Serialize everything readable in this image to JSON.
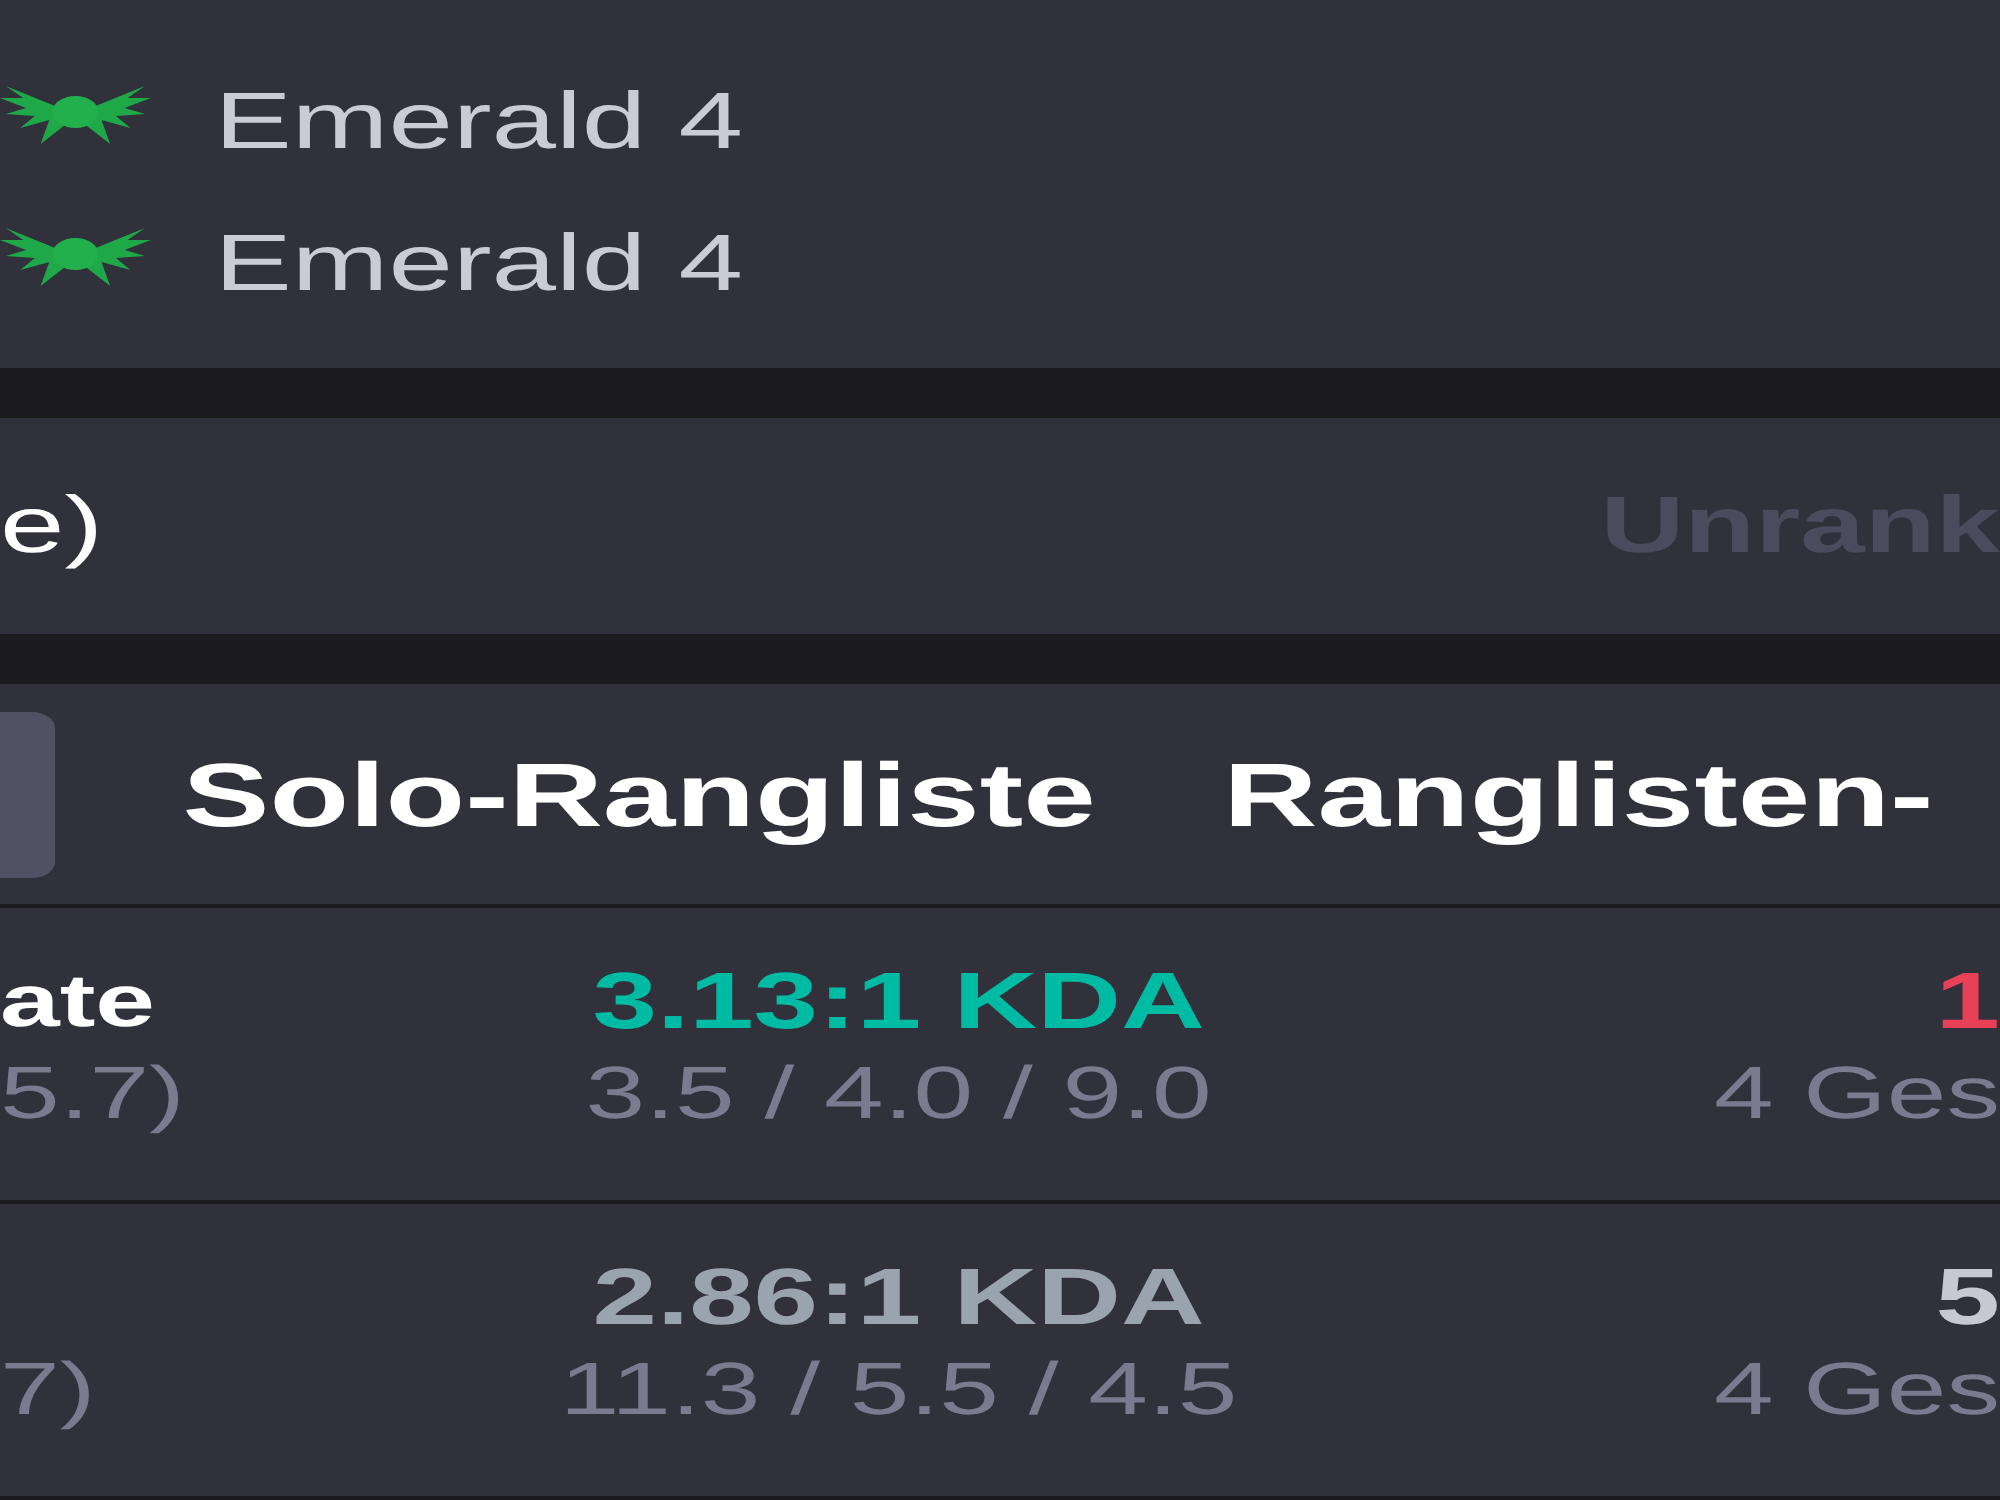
{
  "tier_list": {
    "rows": [
      {
        "tier": "Emerald 4"
      },
      {
        "tier": "Emerald 4"
      }
    ]
  },
  "queue_panel": {
    "title": "e)",
    "status": "Unrank"
  },
  "tabs": [
    {
      "selected": true
    },
    {
      "label": "Solo-Rangliste",
      "selected": false
    },
    {
      "label": "Ranglisten-",
      "selected": false
    }
  ],
  "champion_table": {
    "rows": [
      {
        "name": "ate",
        "cs": "5.7)",
        "kda": {
          "text": "3.13:1 KDA",
          "color": "#00bba3"
        },
        "kda_detail": "3.5 / 4.0 / 9.0",
        "win_rate": {
          "text": "1",
          "color": "#e84057"
        },
        "games": "4 Ges"
      },
      {
        "cs": "7)",
        "kda": {
          "text": "2.86:1 KDA",
          "color": "#9aa4af"
        },
        "kda_detail": "11.3 / 5.5 / 4.5",
        "win_rate": {
          "text": "5",
          "color": "#c8c8d4"
        },
        "games": "4 Ges"
      }
    ]
  }
}
